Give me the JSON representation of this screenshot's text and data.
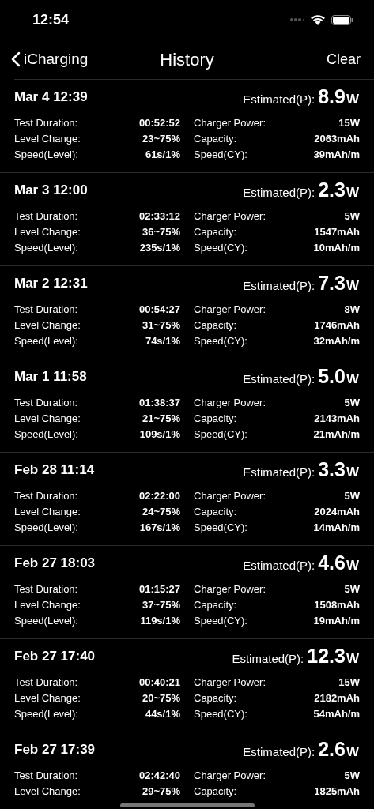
{
  "status_bar": {
    "time": "12:54"
  },
  "nav": {
    "back_label": "iCharging",
    "title": "History",
    "action": "Clear"
  },
  "records": [
    {
      "date": "Mar 4 12:39",
      "estimated_label": "Estimated(P):",
      "estimated_value": "8.9",
      "estimated_unit": "W",
      "rows": [
        {
          "label": "Test Duration:",
          "value": "00:52:52",
          "label2": "Charger Power:",
          "value2": "15W"
        },
        {
          "label": "Level Change:",
          "value": "23~75%",
          "label2": "Capacity:",
          "value2": "2063mAh"
        },
        {
          "label": "Speed(Level):",
          "value": "61s/1%",
          "label2": "Speed(CY):",
          "value2": "39mAh/m"
        }
      ]
    },
    {
      "date": "Mar 3 12:00",
      "estimated_label": "Estimated(P):",
      "estimated_value": "2.3",
      "estimated_unit": "W",
      "rows": [
        {
          "label": "Test Duration:",
          "value": "02:33:12",
          "label2": "Charger Power:",
          "value2": "5W"
        },
        {
          "label": "Level Change:",
          "value": "36~75%",
          "label2": "Capacity:",
          "value2": "1547mAh"
        },
        {
          "label": "Speed(Level):",
          "value": "235s/1%",
          "label2": "Speed(CY):",
          "value2": "10mAh/m"
        }
      ]
    },
    {
      "date": "Mar 2 12:31",
      "estimated_label": "Estimated(P):",
      "estimated_value": "7.3",
      "estimated_unit": "W",
      "rows": [
        {
          "label": "Test Duration:",
          "value": "00:54:27",
          "label2": "Charger Power:",
          "value2": "8W"
        },
        {
          "label": "Level Change:",
          "value": "31~75%",
          "label2": "Capacity:",
          "value2": "1746mAh"
        },
        {
          "label": "Speed(Level):",
          "value": "74s/1%",
          "label2": "Speed(CY):",
          "value2": "32mAh/m"
        }
      ]
    },
    {
      "date": "Mar 1 11:58",
      "estimated_label": "Estimated(P):",
      "estimated_value": "5.0",
      "estimated_unit": "W",
      "rows": [
        {
          "label": "Test Duration:",
          "value": "01:38:37",
          "label2": "Charger Power:",
          "value2": "5W"
        },
        {
          "label": "Level Change:",
          "value": "21~75%",
          "label2": "Capacity:",
          "value2": "2143mAh"
        },
        {
          "label": "Speed(Level):",
          "value": "109s/1%",
          "label2": "Speed(CY):",
          "value2": "21mAh/m"
        }
      ]
    },
    {
      "date": "Feb 28 11:14",
      "estimated_label": "Estimated(P):",
      "estimated_value": "3.3",
      "estimated_unit": "W",
      "rows": [
        {
          "label": "Test Duration:",
          "value": "02:22:00",
          "label2": "Charger Power:",
          "value2": "5W"
        },
        {
          "label": "Level Change:",
          "value": "24~75%",
          "label2": "Capacity:",
          "value2": "2024mAh"
        },
        {
          "label": "Speed(Level):",
          "value": "167s/1%",
          "label2": "Speed(CY):",
          "value2": "14mAh/m"
        }
      ]
    },
    {
      "date": "Feb 27 18:03",
      "estimated_label": "Estimated(P):",
      "estimated_value": "4.6",
      "estimated_unit": "W",
      "rows": [
        {
          "label": "Test Duration:",
          "value": "01:15:27",
          "label2": "Charger Power:",
          "value2": "5W"
        },
        {
          "label": "Level Change:",
          "value": "37~75%",
          "label2": "Capacity:",
          "value2": "1508mAh"
        },
        {
          "label": "Speed(Level):",
          "value": "119s/1%",
          "label2": "Speed(CY):",
          "value2": "19mAh/m"
        }
      ]
    },
    {
      "date": "Feb 27 17:40",
      "estimated_label": "Estimated(P):",
      "estimated_value": "12.3",
      "estimated_unit": "W",
      "rows": [
        {
          "label": "Test Duration:",
          "value": "00:40:21",
          "label2": "Charger Power:",
          "value2": "15W"
        },
        {
          "label": "Level Change:",
          "value": "20~75%",
          "label2": "Capacity:",
          "value2": "2182mAh"
        },
        {
          "label": "Speed(Level):",
          "value": "44s/1%",
          "label2": "Speed(CY):",
          "value2": "54mAh/m"
        }
      ]
    },
    {
      "date": "Feb 27 17:39",
      "estimated_label": "Estimated(P):",
      "estimated_value": "2.6",
      "estimated_unit": "W",
      "rows": [
        {
          "label": "Test Duration:",
          "value": "02:42:40",
          "label2": "Charger Power:",
          "value2": "5W"
        },
        {
          "label": "Level Change:",
          "value": "29~75%",
          "label2": "Capacity:",
          "value2": "1825mAh"
        }
      ]
    }
  ]
}
